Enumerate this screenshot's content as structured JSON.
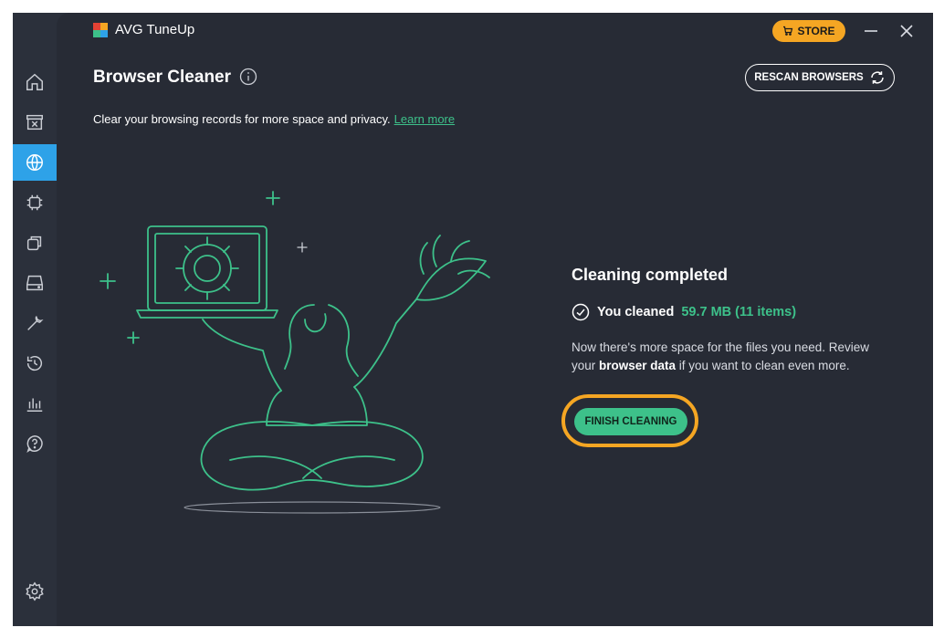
{
  "app": {
    "title": "AVG TuneUp"
  },
  "header": {
    "store_label": "STORE",
    "rescan_label": "RESCAN BROWSERS"
  },
  "page": {
    "title": "Browser Cleaner",
    "subtitle": "Clear your browsing records for more space and privacy.",
    "learn_more": "Learn more"
  },
  "result": {
    "title": "Cleaning completed",
    "cleaned_prefix": "You cleaned",
    "cleaned_amount": "59.7 MB (11 items)",
    "desc_1": "Now there's more space for the files you need. Review your ",
    "desc_bold": "browser data",
    "desc_2": " if you want to clean even more.",
    "finish_label": "FINISH CLEANING"
  },
  "sidebar": {
    "items": [
      {
        "icon": "home-icon"
      },
      {
        "icon": "archive-icon"
      },
      {
        "icon": "browser-globe-icon",
        "active": true
      },
      {
        "icon": "cpu-icon"
      },
      {
        "icon": "windows-icon"
      },
      {
        "icon": "disk-icon"
      },
      {
        "icon": "wrench-icon"
      },
      {
        "icon": "history-icon"
      },
      {
        "icon": "chart-icon"
      },
      {
        "icon": "help-icon"
      },
      {
        "icon": "settings-icon"
      }
    ]
  },
  "colors": {
    "accent_green": "#3dc18a",
    "accent_blue": "#2ea2e8",
    "store_orange": "#f5a623",
    "background": "#272b35"
  }
}
